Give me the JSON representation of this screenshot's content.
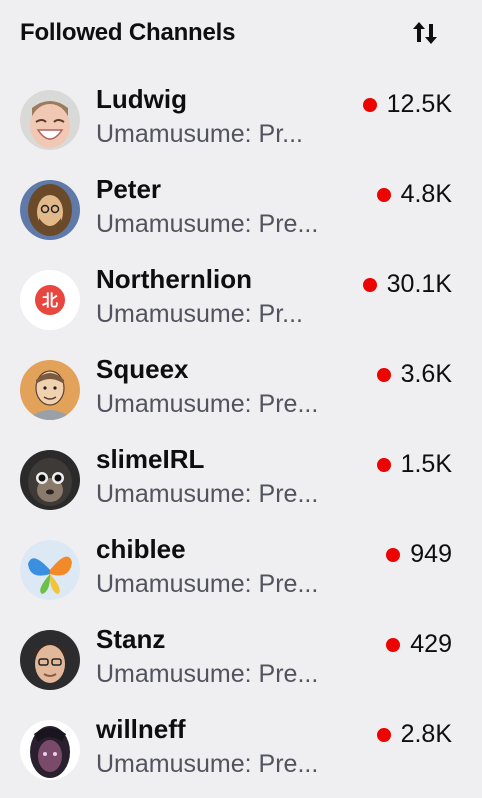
{
  "header": {
    "title": "Followed Channels",
    "sort_icon": "sort-arrows-icon"
  },
  "colors": {
    "background": "#efeff1",
    "live": "#eb0400",
    "muted_text": "#53535f"
  },
  "channels": [
    {
      "name": "Ludwig",
      "game": "Umamusume: Pr...",
      "viewers": "12.5K",
      "avatar_icon": "ludwig-avatar"
    },
    {
      "name": "Peter",
      "game": "Umamusume: Pre...",
      "viewers": "4.8K",
      "avatar_icon": "peter-avatar"
    },
    {
      "name": "Northernlion",
      "game": "Umamusume: Pr...",
      "viewers": "30.1K",
      "avatar_icon": "northernlion-avatar"
    },
    {
      "name": "Squeex",
      "game": "Umamusume: Pre...",
      "viewers": "3.6K",
      "avatar_icon": "squeex-avatar"
    },
    {
      "name": "slimeIRL",
      "game": "Umamusume: Pre...",
      "viewers": "1.5K",
      "avatar_icon": "slimeirl-avatar"
    },
    {
      "name": "chiblee",
      "game": "Umamusume: Pre...",
      "viewers": "949",
      "avatar_icon": "chiblee-avatar"
    },
    {
      "name": "Stanz",
      "game": "Umamusume: Pre...",
      "viewers": "429",
      "avatar_icon": "stanz-avatar"
    },
    {
      "name": "willneff",
      "game": "Umamusume: Pre...",
      "viewers": "2.8K",
      "avatar_icon": "willneff-avatar"
    }
  ]
}
